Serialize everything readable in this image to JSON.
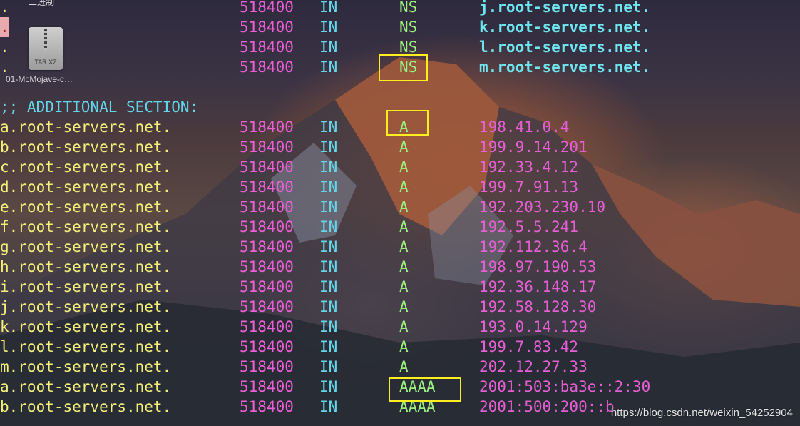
{
  "desktop": {
    "top_label": "二进制",
    "file_icon_ext": "TAR.XZ",
    "file_icon_name": "01-McMojave-c…"
  },
  "authority_rows": [
    {
      "name": ".",
      "ttl": "518400",
      "class": "IN",
      "type": "NS",
      "value": "j.root-servers.net."
    },
    {
      "name": ".",
      "ttl": "518400",
      "class": "IN",
      "type": "NS",
      "value": "k.root-servers.net."
    },
    {
      "name": ".",
      "ttl": "518400",
      "class": "IN",
      "type": "NS",
      "value": "l.root-servers.net."
    },
    {
      "name": ".",
      "ttl": "518400",
      "class": "IN",
      "type": "NS",
      "value": "m.root-servers.net."
    }
  ],
  "section_header": ";; ADDITIONAL SECTION:",
  "additional_rows": [
    {
      "name": "a.root-servers.net.",
      "ttl": "518400",
      "class": "IN",
      "type": "A",
      "value": "198.41.0.4"
    },
    {
      "name": "b.root-servers.net.",
      "ttl": "518400",
      "class": "IN",
      "type": "A",
      "value": "199.9.14.201"
    },
    {
      "name": "c.root-servers.net.",
      "ttl": "518400",
      "class": "IN",
      "type": "A",
      "value": "192.33.4.12"
    },
    {
      "name": "d.root-servers.net.",
      "ttl": "518400",
      "class": "IN",
      "type": "A",
      "value": "199.7.91.13"
    },
    {
      "name": "e.root-servers.net.",
      "ttl": "518400",
      "class": "IN",
      "type": "A",
      "value": "192.203.230.10"
    },
    {
      "name": "f.root-servers.net.",
      "ttl": "518400",
      "class": "IN",
      "type": "A",
      "value": "192.5.5.241"
    },
    {
      "name": "g.root-servers.net.",
      "ttl": "518400",
      "class": "IN",
      "type": "A",
      "value": "192.112.36.4"
    },
    {
      "name": "h.root-servers.net.",
      "ttl": "518400",
      "class": "IN",
      "type": "A",
      "value": "198.97.190.53"
    },
    {
      "name": "i.root-servers.net.",
      "ttl": "518400",
      "class": "IN",
      "type": "A",
      "value": "192.36.148.17"
    },
    {
      "name": "j.root-servers.net.",
      "ttl": "518400",
      "class": "IN",
      "type": "A",
      "value": "192.58.128.30"
    },
    {
      "name": "k.root-servers.net.",
      "ttl": "518400",
      "class": "IN",
      "type": "A",
      "value": "193.0.14.129"
    },
    {
      "name": "l.root-servers.net.",
      "ttl": "518400",
      "class": "IN",
      "type": "A",
      "value": "199.7.83.42"
    },
    {
      "name": "m.root-servers.net.",
      "ttl": "518400",
      "class": "IN",
      "type": "A",
      "value": "202.12.27.33"
    },
    {
      "name": "a.root-servers.net.",
      "ttl": "518400",
      "class": "IN",
      "type": "AAAA",
      "value": "2001:503:ba3e::2:30"
    },
    {
      "name": "b.root-servers.net.",
      "ttl": "518400",
      "class": "IN",
      "type": "AAAA",
      "value": "2001:500:200::b"
    }
  ],
  "watermark": "https://blog.csdn.net/weixin_54252904",
  "colors": {
    "name": "#f2f07a",
    "ttl": "#ee5fd6",
    "class": "#65d6ea",
    "type": "#9cf07f",
    "ns_value": "#6ee6f0",
    "ip_value": "#e45fd2",
    "highlight_box": "#ffef1f"
  }
}
